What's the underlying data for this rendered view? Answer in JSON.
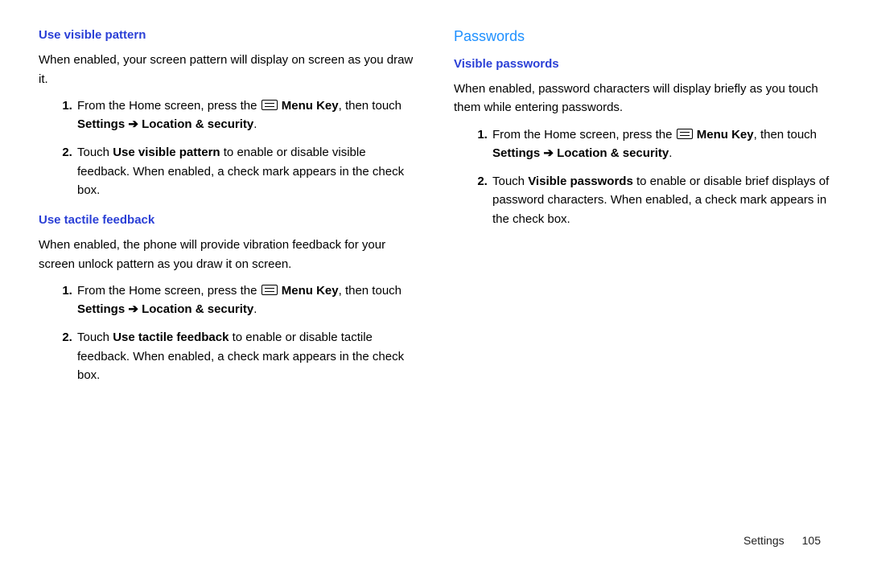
{
  "left": {
    "h1": "Use visible pattern",
    "p1": "When enabled, your screen pattern will display on screen as you draw it.",
    "s1a": "From the Home screen, press the ",
    "s1b": " Menu Key",
    "s1c": ", then touch ",
    "s1d": "Settings ➔ Location & security",
    "s1e": ".",
    "s2a": "Touch ",
    "s2b": "Use visible pattern",
    "s2c": " to enable or disable visible feedback. When enabled, a check mark appears in the check box.",
    "h2": "Use tactile feedback",
    "p2": "When enabled, the phone will provide vibration feedback for your screen unlock pattern as you draw it on screen.",
    "t1a": "From the Home screen, press the ",
    "t1b": " Menu Key",
    "t1c": ", then touch ",
    "t1d": "Settings ➔ Location & security",
    "t1e": ".",
    "t2a": "Touch ",
    "t2b": "Use tactile feedback",
    "t2c": " to enable or disable tactile feedback. When enabled, a check mark appears in the check box."
  },
  "right": {
    "h0": "Passwords",
    "h1": "Visible passwords",
    "p1": "When enabled, password characters will display briefly as you touch them while entering passwords.",
    "s1a": "From the Home screen, press the ",
    "s1b": " Menu Key",
    "s1c": ", then touch ",
    "s1d": "Settings ➔ Location & security",
    "s1e": ".",
    "s2a": "Touch ",
    "s2b": "Visible passwords",
    "s2c": " to enable or disable brief displays of password characters. When enabled, a check mark appears in the check box."
  },
  "footer": {
    "section": "Settings",
    "page": "105"
  }
}
